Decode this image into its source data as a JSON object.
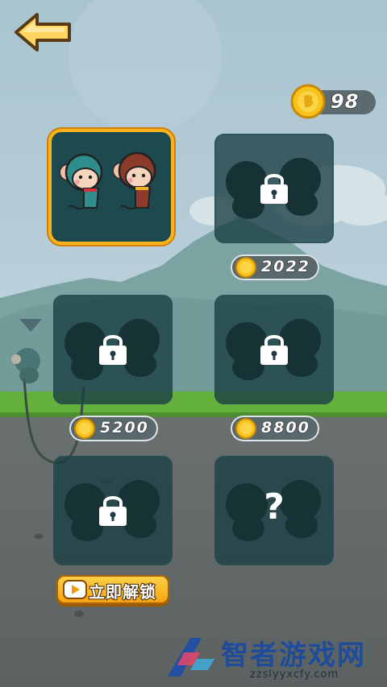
{
  "header": {
    "back_icon": "left-arrow-icon"
  },
  "coins": {
    "value": "98",
    "icon": "coin-icon"
  },
  "characters": [
    {
      "state": "selected",
      "label": "monkey-pair"
    },
    {
      "state": "locked",
      "price": "2022"
    },
    {
      "state": "locked",
      "price": "5200"
    },
    {
      "state": "locked",
      "price": "8800"
    },
    {
      "state": "locked",
      "action": "立即解锁"
    },
    {
      "state": "mystery",
      "symbol": "?"
    }
  ],
  "watermark": {
    "title": "智者游戏网",
    "url": "zzslyyxcfy.com"
  },
  "colors": {
    "accent": "#f9b31c",
    "slot": "#1a3e42",
    "coin": "#f7c21a"
  }
}
